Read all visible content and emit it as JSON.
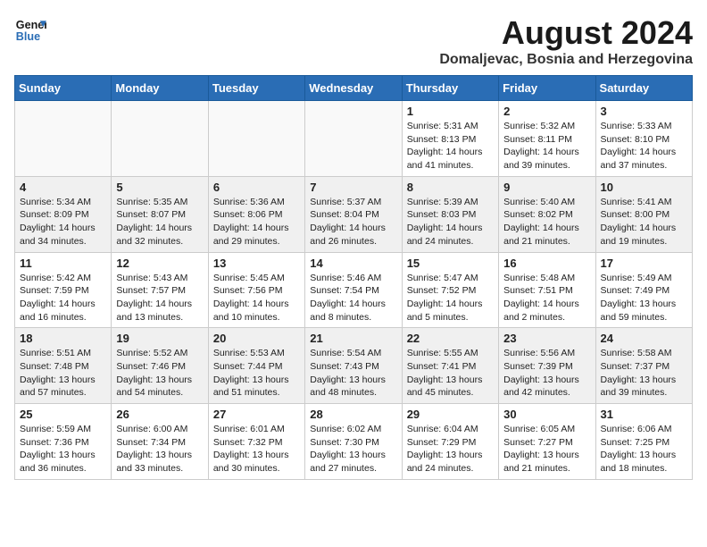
{
  "logo": {
    "line1": "General",
    "line2": "Blue"
  },
  "title": "August 2024",
  "location": "Domaljevac, Bosnia and Herzegovina",
  "weekdays": [
    "Sunday",
    "Monday",
    "Tuesday",
    "Wednesday",
    "Thursday",
    "Friday",
    "Saturday"
  ],
  "weeks": [
    [
      {
        "day": "",
        "info": ""
      },
      {
        "day": "",
        "info": ""
      },
      {
        "day": "",
        "info": ""
      },
      {
        "day": "",
        "info": ""
      },
      {
        "day": "1",
        "info": "Sunrise: 5:31 AM\nSunset: 8:13 PM\nDaylight: 14 hours\nand 41 minutes."
      },
      {
        "day": "2",
        "info": "Sunrise: 5:32 AM\nSunset: 8:11 PM\nDaylight: 14 hours\nand 39 minutes."
      },
      {
        "day": "3",
        "info": "Sunrise: 5:33 AM\nSunset: 8:10 PM\nDaylight: 14 hours\nand 37 minutes."
      }
    ],
    [
      {
        "day": "4",
        "info": "Sunrise: 5:34 AM\nSunset: 8:09 PM\nDaylight: 14 hours\nand 34 minutes."
      },
      {
        "day": "5",
        "info": "Sunrise: 5:35 AM\nSunset: 8:07 PM\nDaylight: 14 hours\nand 32 minutes."
      },
      {
        "day": "6",
        "info": "Sunrise: 5:36 AM\nSunset: 8:06 PM\nDaylight: 14 hours\nand 29 minutes."
      },
      {
        "day": "7",
        "info": "Sunrise: 5:37 AM\nSunset: 8:04 PM\nDaylight: 14 hours\nand 26 minutes."
      },
      {
        "day": "8",
        "info": "Sunrise: 5:39 AM\nSunset: 8:03 PM\nDaylight: 14 hours\nand 24 minutes."
      },
      {
        "day": "9",
        "info": "Sunrise: 5:40 AM\nSunset: 8:02 PM\nDaylight: 14 hours\nand 21 minutes."
      },
      {
        "day": "10",
        "info": "Sunrise: 5:41 AM\nSunset: 8:00 PM\nDaylight: 14 hours\nand 19 minutes."
      }
    ],
    [
      {
        "day": "11",
        "info": "Sunrise: 5:42 AM\nSunset: 7:59 PM\nDaylight: 14 hours\nand 16 minutes."
      },
      {
        "day": "12",
        "info": "Sunrise: 5:43 AM\nSunset: 7:57 PM\nDaylight: 14 hours\nand 13 minutes."
      },
      {
        "day": "13",
        "info": "Sunrise: 5:45 AM\nSunset: 7:56 PM\nDaylight: 14 hours\nand 10 minutes."
      },
      {
        "day": "14",
        "info": "Sunrise: 5:46 AM\nSunset: 7:54 PM\nDaylight: 14 hours\nand 8 minutes."
      },
      {
        "day": "15",
        "info": "Sunrise: 5:47 AM\nSunset: 7:52 PM\nDaylight: 14 hours\nand 5 minutes."
      },
      {
        "day": "16",
        "info": "Sunrise: 5:48 AM\nSunset: 7:51 PM\nDaylight: 14 hours\nand 2 minutes."
      },
      {
        "day": "17",
        "info": "Sunrise: 5:49 AM\nSunset: 7:49 PM\nDaylight: 13 hours\nand 59 minutes."
      }
    ],
    [
      {
        "day": "18",
        "info": "Sunrise: 5:51 AM\nSunset: 7:48 PM\nDaylight: 13 hours\nand 57 minutes."
      },
      {
        "day": "19",
        "info": "Sunrise: 5:52 AM\nSunset: 7:46 PM\nDaylight: 13 hours\nand 54 minutes."
      },
      {
        "day": "20",
        "info": "Sunrise: 5:53 AM\nSunset: 7:44 PM\nDaylight: 13 hours\nand 51 minutes."
      },
      {
        "day": "21",
        "info": "Sunrise: 5:54 AM\nSunset: 7:43 PM\nDaylight: 13 hours\nand 48 minutes."
      },
      {
        "day": "22",
        "info": "Sunrise: 5:55 AM\nSunset: 7:41 PM\nDaylight: 13 hours\nand 45 minutes."
      },
      {
        "day": "23",
        "info": "Sunrise: 5:56 AM\nSunset: 7:39 PM\nDaylight: 13 hours\nand 42 minutes."
      },
      {
        "day": "24",
        "info": "Sunrise: 5:58 AM\nSunset: 7:37 PM\nDaylight: 13 hours\nand 39 minutes."
      }
    ],
    [
      {
        "day": "25",
        "info": "Sunrise: 5:59 AM\nSunset: 7:36 PM\nDaylight: 13 hours\nand 36 minutes."
      },
      {
        "day": "26",
        "info": "Sunrise: 6:00 AM\nSunset: 7:34 PM\nDaylight: 13 hours\nand 33 minutes."
      },
      {
        "day": "27",
        "info": "Sunrise: 6:01 AM\nSunset: 7:32 PM\nDaylight: 13 hours\nand 30 minutes."
      },
      {
        "day": "28",
        "info": "Sunrise: 6:02 AM\nSunset: 7:30 PM\nDaylight: 13 hours\nand 27 minutes."
      },
      {
        "day": "29",
        "info": "Sunrise: 6:04 AM\nSunset: 7:29 PM\nDaylight: 13 hours\nand 24 minutes."
      },
      {
        "day": "30",
        "info": "Sunrise: 6:05 AM\nSunset: 7:27 PM\nDaylight: 13 hours\nand 21 minutes."
      },
      {
        "day": "31",
        "info": "Sunrise: 6:06 AM\nSunset: 7:25 PM\nDaylight: 13 hours\nand 18 minutes."
      }
    ]
  ]
}
